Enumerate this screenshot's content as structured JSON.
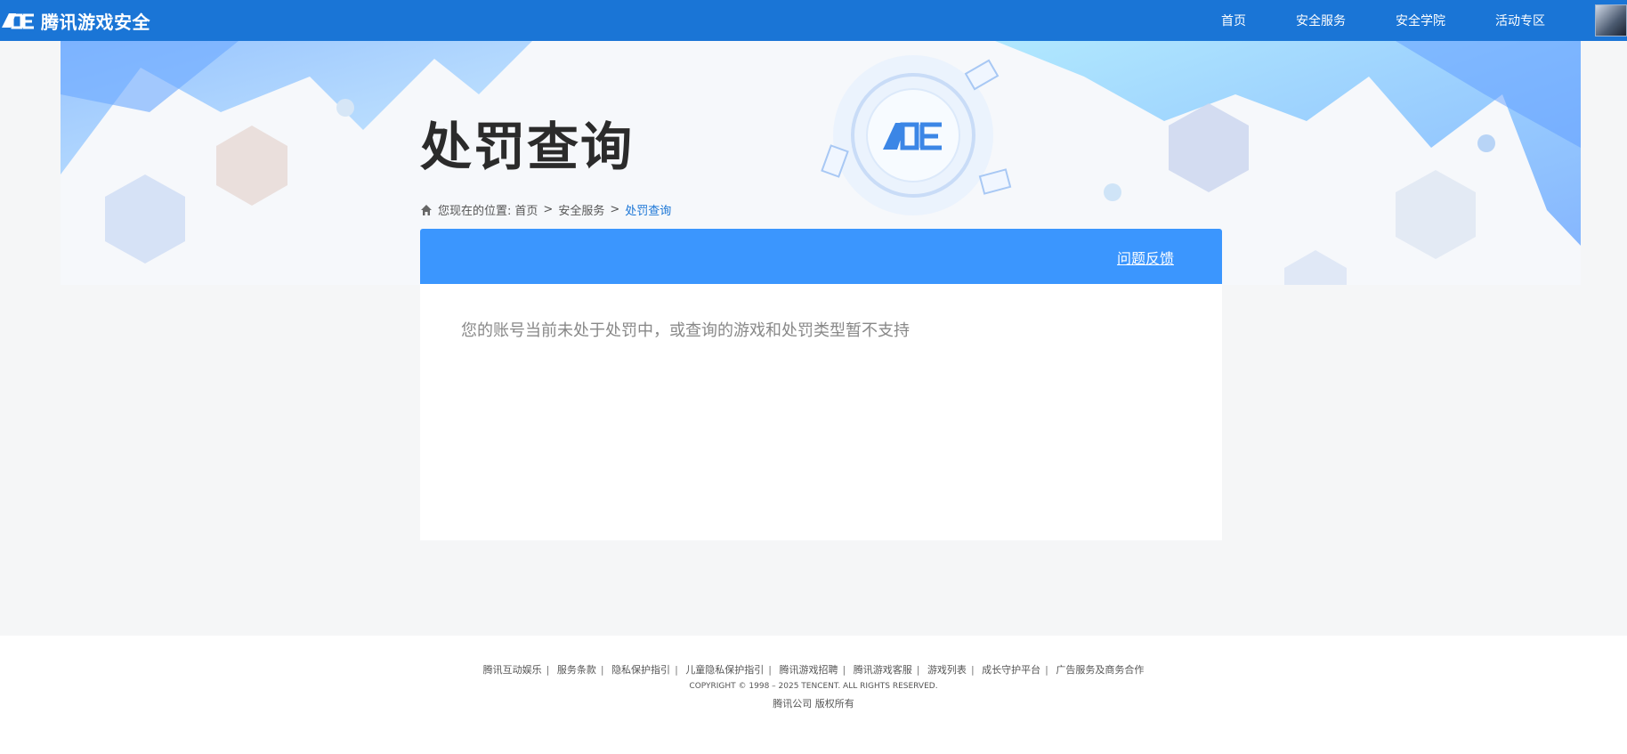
{
  "header": {
    "brand": "腾讯游戏安全",
    "nav": [
      "首页",
      "安全服务",
      "安全学院",
      "活动专区"
    ]
  },
  "page": {
    "title": "处罚查询",
    "breadcrumb": {
      "prefix": "您现在的位置:",
      "items": [
        "首页",
        "安全服务",
        "处罚查询"
      ]
    }
  },
  "panel": {
    "feedback_link": "问题反馈",
    "message": "您的账号当前未处于处罚中，或查询的游戏和处罚类型暂不支持"
  },
  "footer": {
    "links": [
      "腾讯互动娱乐",
      "服务条款",
      "隐私保护指引",
      "儿童隐私保护指引",
      "腾讯游戏招聘",
      "腾讯游戏客服",
      "游戏列表",
      "成长守护平台",
      "广告服务及商务合作"
    ],
    "copyright": "COPYRIGHT © 1998 – 2025 TENCENT. ALL RIGHTS RESERVED.",
    "company": "腾讯公司 版权所有"
  },
  "colors": {
    "nav_bg": "#1a75d6",
    "panel_head": "#3b96fe",
    "link_current": "#1a75d6"
  },
  "icons": {
    "logo": "ace-logo",
    "home": "home-icon"
  }
}
